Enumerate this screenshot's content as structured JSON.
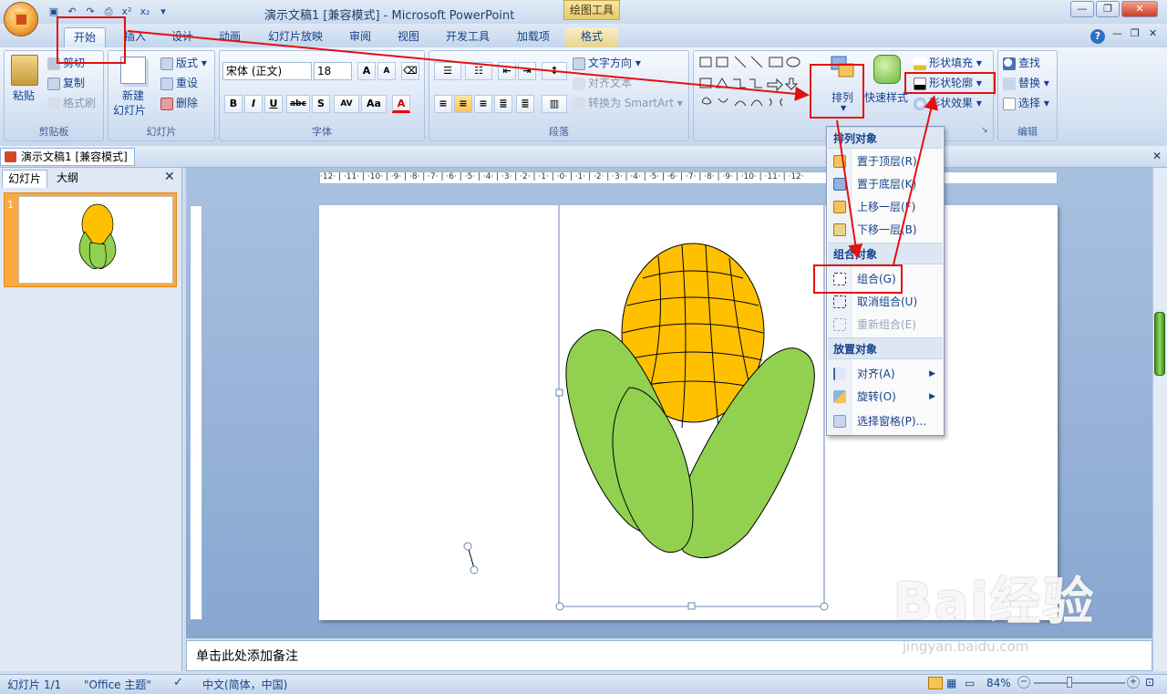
{
  "window": {
    "title": "演示文稿1 [兼容模式] - Microsoft PowerPoint",
    "context_tab": "绘图工具"
  },
  "tabs": [
    "开始",
    "插入",
    "设计",
    "动画",
    "幻灯片放映",
    "审阅",
    "视图",
    "开发工具",
    "加载项",
    "格式"
  ],
  "clipboard": {
    "paste": "粘贴",
    "cut": "剪切",
    "copy": "复制",
    "format_painter": "格式刷",
    "label": "剪贴板"
  },
  "slides_group": {
    "new_slide": "新建\n幻灯片",
    "new_slide_l1": "新建",
    "new_slide_l2": "幻灯片",
    "layout": "版式",
    "reset": "重设",
    "delete": "删除",
    "label": "幻灯片"
  },
  "font": {
    "name": "宋体 (正文)",
    "size": "18",
    "bold": "B",
    "italic": "I",
    "underline": "U",
    "strike": "abc",
    "shadow": "S",
    "spacing": "AV",
    "case": "Aa",
    "color": "A",
    "label": "字体"
  },
  "paragraph": {
    "text_direction": "文字方向",
    "align_text": "对齐文本",
    "smartart": "转换为 SmartArt",
    "label": "段落"
  },
  "drawing": {
    "arrange": "排列",
    "quick_styles": "快速样式",
    "fill": "形状填充",
    "outline": "形状轮廓",
    "effects": "形状效果"
  },
  "editing": {
    "find": "查找",
    "replace": "替换",
    "select": "选择",
    "label": "编辑"
  },
  "doc_tab": "演示文稿1 [兼容模式]",
  "panel_tabs": {
    "slides": "幻灯片",
    "outline": "大纲"
  },
  "thumbnail_number": "1",
  "menu": {
    "sections": [
      {
        "title": "排列对象",
        "items": [
          {
            "label": "置于顶层(R)"
          },
          {
            "label": "置于底层(K)"
          },
          {
            "label": "上移一层(F)"
          },
          {
            "label": "下移一层(B)"
          }
        ]
      },
      {
        "title": "组合对象",
        "items": [
          {
            "label": "组合(G)"
          },
          {
            "label": "取消组合(U)"
          },
          {
            "label": "重新组合(E)"
          }
        ]
      },
      {
        "title": "放置对象",
        "items": [
          {
            "label": "对齐(A)"
          },
          {
            "label": "旋转(O)"
          },
          {
            "label": "选择窗格(P)..."
          }
        ]
      }
    ]
  },
  "hruler_text": "·12· | ·11· | ·10· | ·9· | ·8· | ·7· | ·6· | ·5· | ·4· | ·3· | ·2· | ·1· | ·0· | ·1· | ·2· | ·3· | ·4· | ·5· | ·6· | ·7· | ·8· | ·9· | ·10· | ·11· | ·12·",
  "notes_placeholder": "单击此处添加备注",
  "status": {
    "slide": "幻灯片 1/1",
    "theme": "\"Office 主题\"",
    "language": "中文(简体，中国)",
    "zoom": "84%"
  },
  "watermark": {
    "brand": "Bai经验",
    "url": "jingyan.baidu.com"
  },
  "colors": {
    "highlight_red": "#e4100f",
    "corn_kernel": "#ffc000",
    "husk_green": "#92d050"
  }
}
